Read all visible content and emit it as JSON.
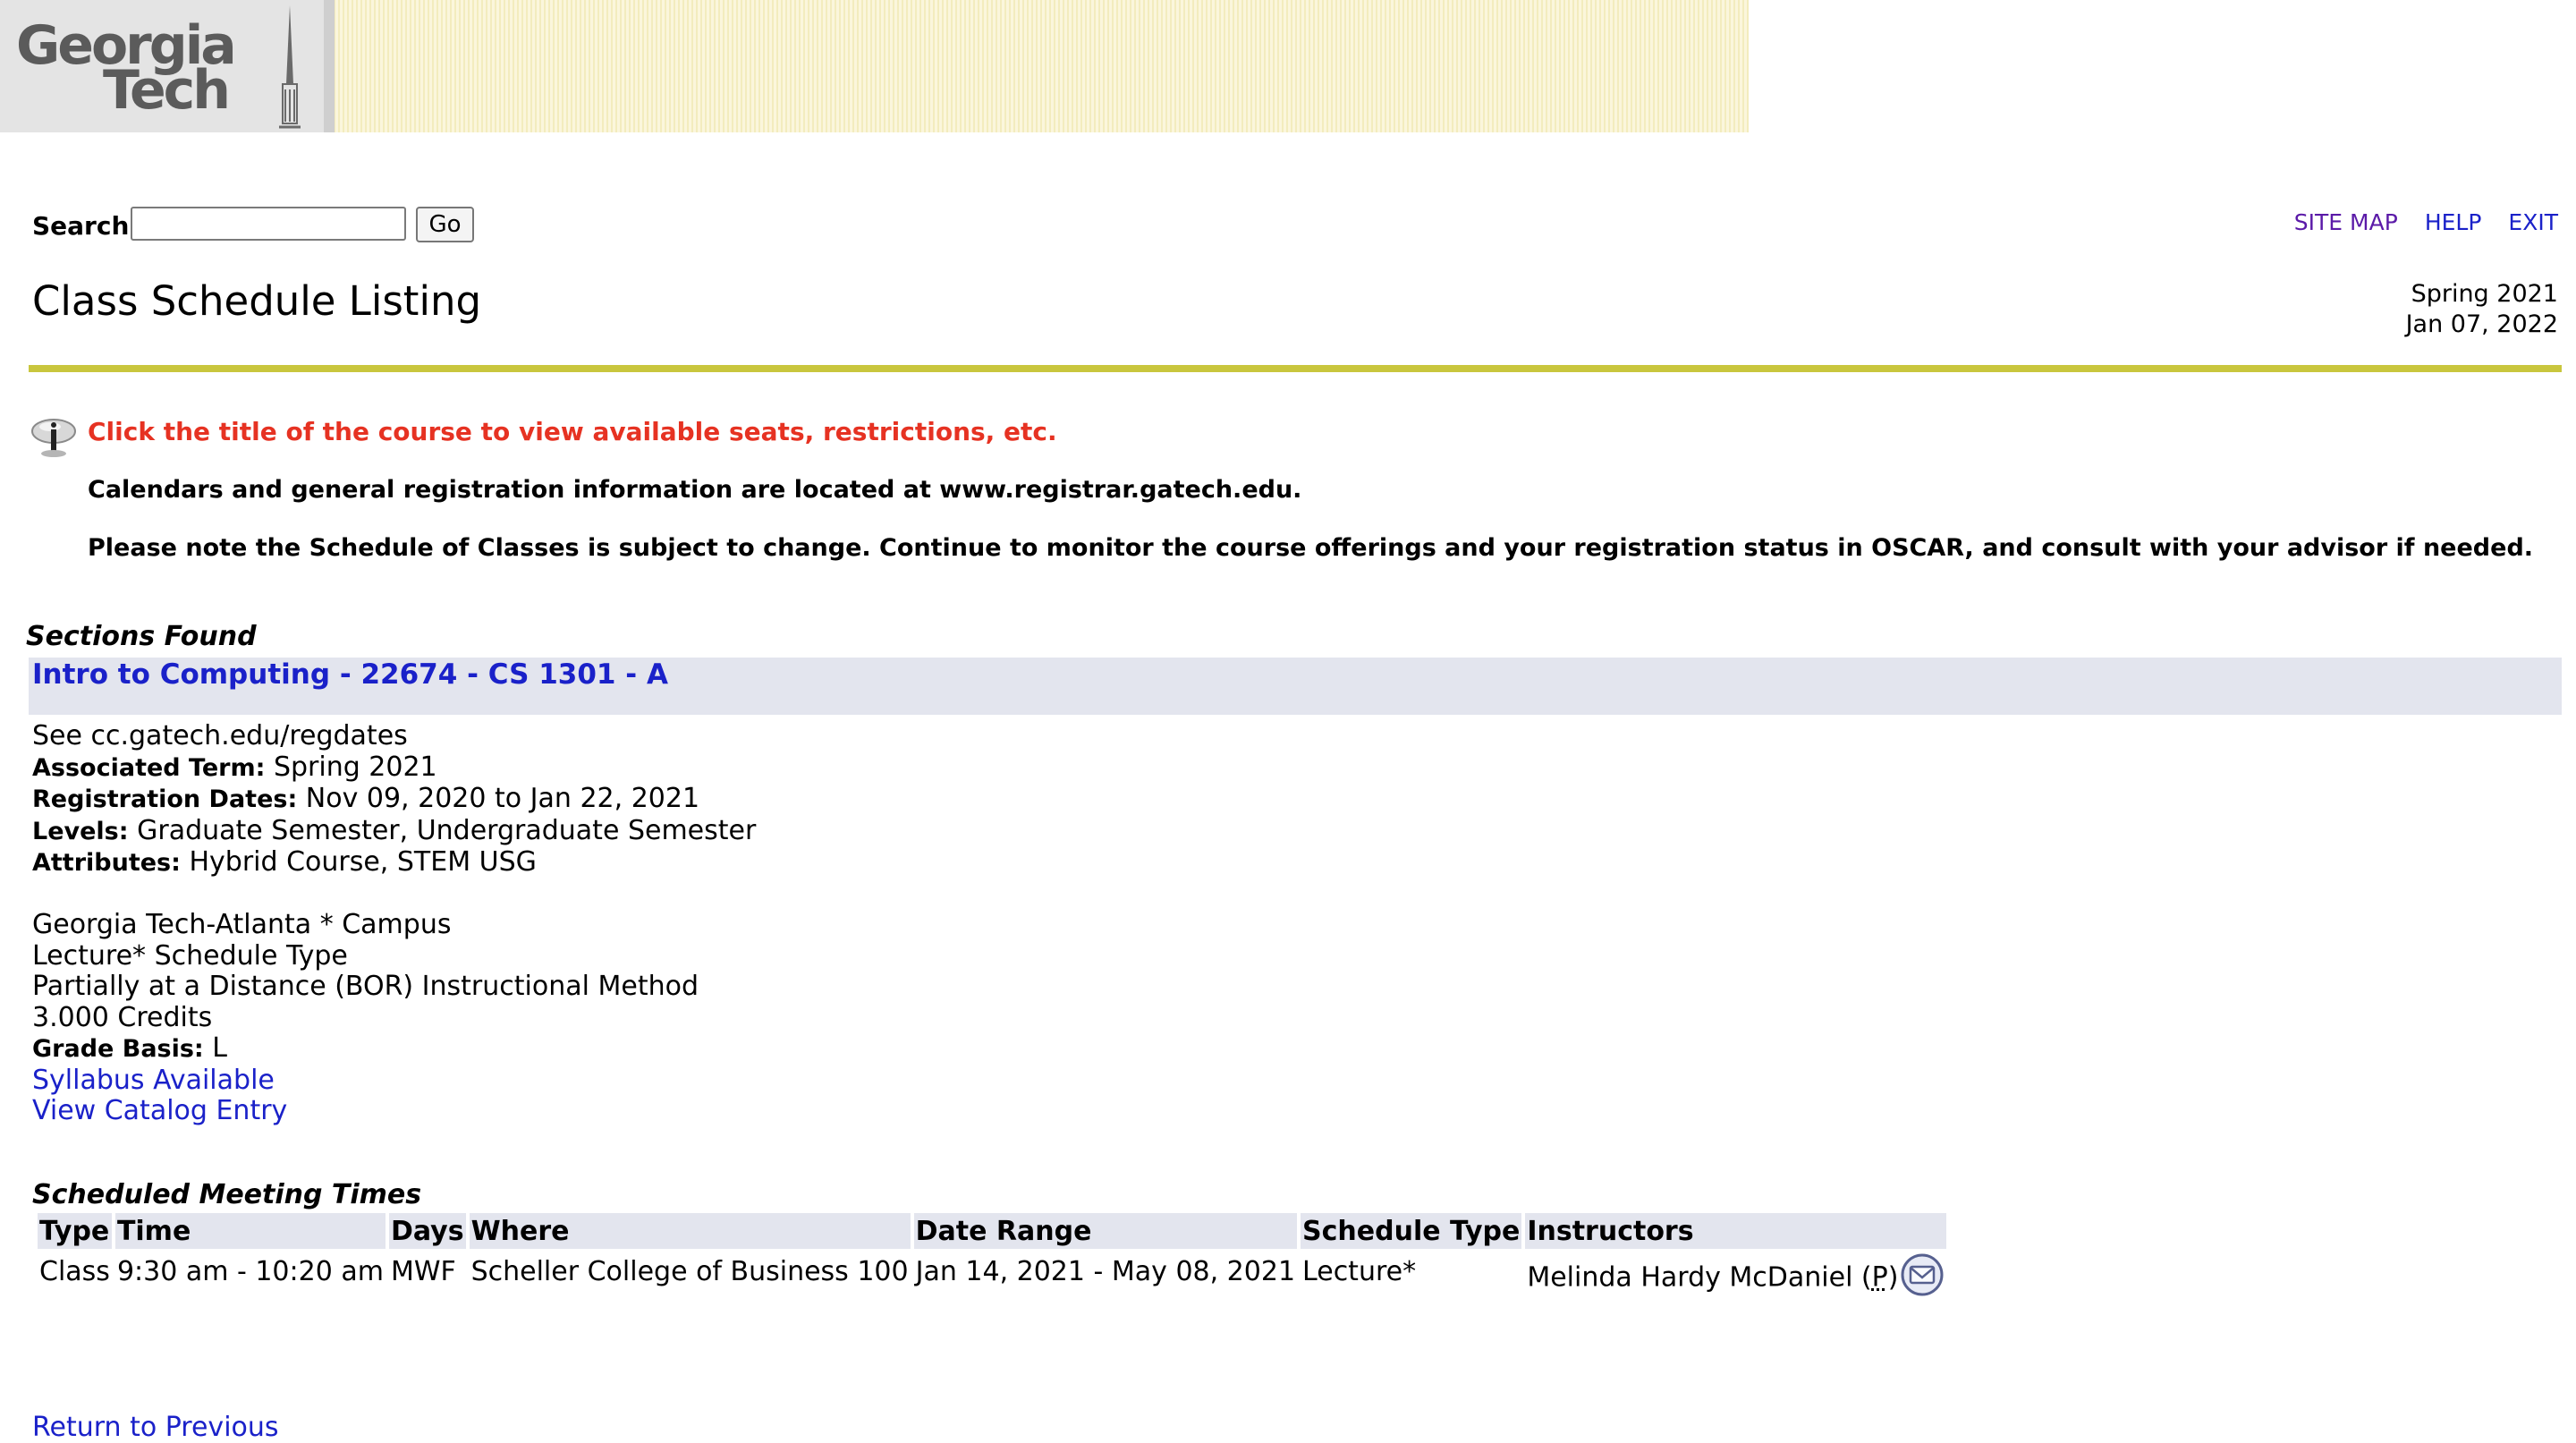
{
  "header": {
    "logo_line1": "Georgia",
    "logo_line2": "Tech",
    "banner_color": "#f3ecbe"
  },
  "search": {
    "label": "Search",
    "value": "",
    "placeholder": "",
    "go_label": "Go"
  },
  "top_links": {
    "site_map": "SITE MAP",
    "help": "HELP",
    "exit": "EXIT"
  },
  "page": {
    "title": "Class Schedule Listing",
    "term": "Spring 2021",
    "date": "Jan 07, 2022"
  },
  "info": {
    "highlight": "Click the title of the course to view available seats, restrictions, etc.",
    "line1": "Calendars and general registration information are located at www.registrar.gatech.edu.",
    "line2": "Please note the Schedule of Classes is subject to change. Continue to monitor the course offerings and your registration status in OSCAR, and consult with your advisor if needed."
  },
  "sections_found_label": "Sections Found",
  "section": {
    "title": "Intro to Computing - 22674 - CS 1301 - A",
    "note": "See cc.gatech.edu/regdates",
    "associated_term_label": "Associated Term:",
    "associated_term": "Spring 2021",
    "registration_dates_label": "Registration Dates:",
    "registration_dates": "Nov 09, 2020 to Jan 22, 2021",
    "levels_label": "Levels:",
    "levels": "Graduate Semester, Undergraduate Semester",
    "attributes_label": "Attributes:",
    "attributes": "Hybrid Course, STEM USG",
    "campus": "Georgia Tech-Atlanta * Campus",
    "schedule_type": "Lecture* Schedule Type",
    "instructional_method": "Partially at a Distance (BOR) Instructional Method",
    "credits": "3.000 Credits",
    "grade_basis_label": "Grade Basis:",
    "grade_basis": "L",
    "syllabus_link": "Syllabus Available",
    "catalog_link": "View Catalog Entry"
  },
  "meeting_times": {
    "caption": "Scheduled Meeting Times",
    "headers": [
      "Type",
      "Time",
      "Days",
      "Where",
      "Date Range",
      "Schedule Type",
      "Instructors"
    ],
    "rows": [
      [
        "Class",
        "9:30 am - 10:20 am",
        "MWF",
        "Scheller College of Business 100",
        "Jan 14, 2021 - May 08, 2021",
        "Lecture*",
        "Melinda Hardy McDaniel ("
      ]
    ],
    "primary_marker": "P",
    "primary_close": ")"
  },
  "return_link": "Return to Previous",
  "colors": {
    "link": "#1a21c9",
    "visited_link": "#5b1aa8",
    "alert": "#e63222",
    "divider": "#c9c63d",
    "header_row": "#e3e5ee"
  }
}
